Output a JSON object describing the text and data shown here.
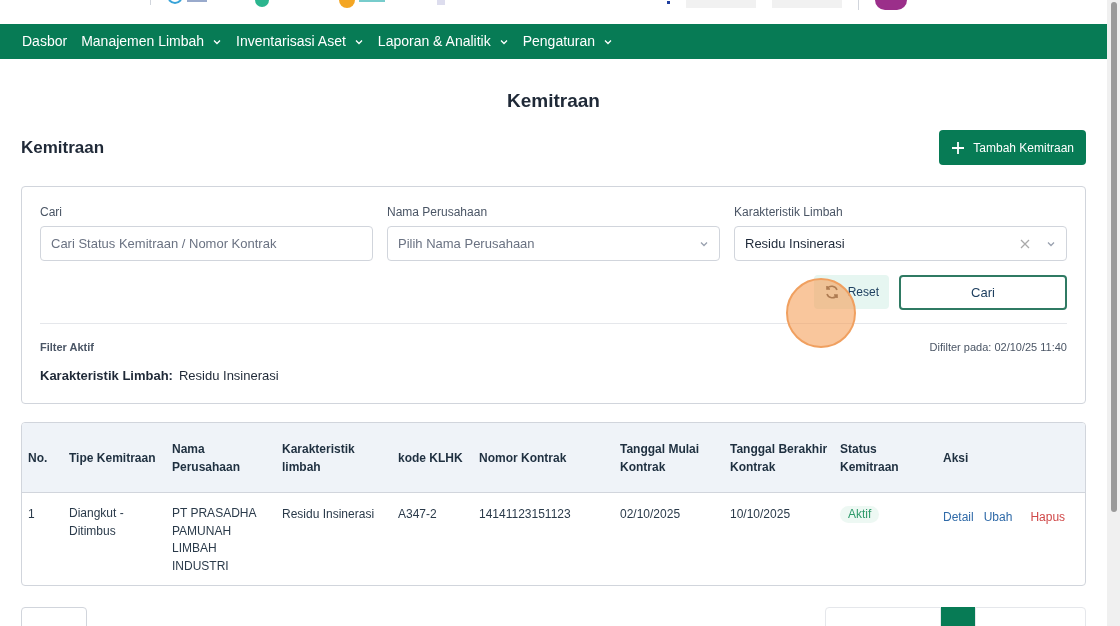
{
  "nav": [
    {
      "label": "Dasbor",
      "dropdown": false
    },
    {
      "label": "Manajemen Limbah",
      "dropdown": true
    },
    {
      "label": "Inventarisasi Aset",
      "dropdown": true
    },
    {
      "label": "Laporan & Analitik",
      "dropdown": true
    },
    {
      "label": "Pengaturan",
      "dropdown": true
    }
  ],
  "page_title": "Kemitraan",
  "section_title": "Kemitraan",
  "add_button": "Tambah Kemitraan",
  "filters": {
    "search": {
      "label": "Cari",
      "placeholder": "Cari Status Kemitraan / Nomor Kontrak"
    },
    "company": {
      "label": "Nama Perusahaan",
      "placeholder": "Pilih Nama Perusahaan"
    },
    "waste": {
      "label": "Karakteristik Limbah",
      "value": "Residu Insinerasi"
    },
    "reset_button": "Reset",
    "search_button": "Cari",
    "active_label": "Filter Aktif",
    "filtered_at": "Difilter pada: 02/10/25 11:40",
    "active": [
      {
        "name": "Karakteristik Limbah:",
        "value": "Residu Insinerasi"
      }
    ]
  },
  "table": {
    "columns": [
      "No.",
      "Tipe Kemitraan",
      "Nama Perusahaan",
      "Karakteristik limbah",
      "kode KLHK",
      "Nomor Kontrak",
      "Tanggal Mulai Kontrak",
      "Tanggal Berakhir Kontrak",
      "Status Kemitraan",
      "Aksi"
    ],
    "rows": [
      {
        "cells": [
          "1",
          "Diangkut - Ditimbus",
          "PT PRASADHA PAMUNAH LIMBAH INDUSTRI",
          "Residu Insinerasi",
          "A347-2",
          "14141123151123",
          "02/10/2025",
          "10/10/2025"
        ],
        "status": "Aktif",
        "actions": [
          {
            "label": "Detail",
            "kind": "normal"
          },
          {
            "label": "Ubah",
            "kind": "normal"
          },
          {
            "label": "Hapus",
            "kind": "danger"
          }
        ]
      }
    ]
  }
}
